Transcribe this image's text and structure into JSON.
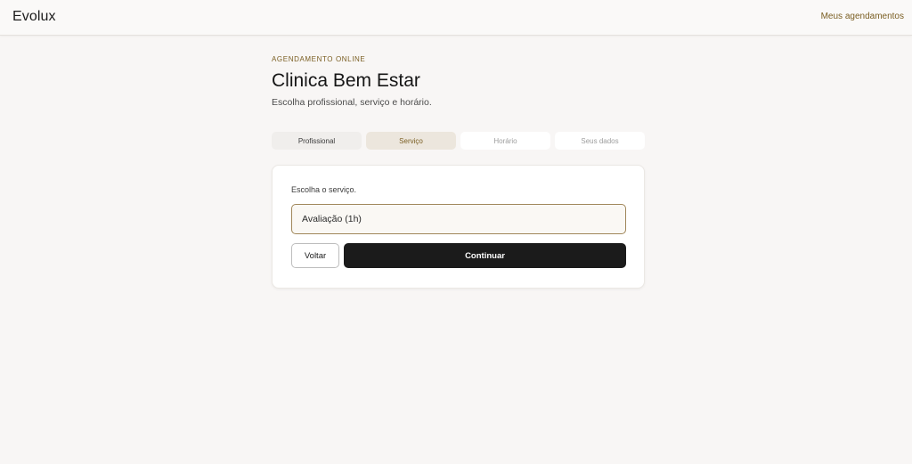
{
  "header": {
    "brand": "Evolux",
    "my_appointments_link": "Meus agendamentos"
  },
  "intro": {
    "eyebrow": "AGENDAMENTO ONLINE",
    "clinic_name": "Clinica Bem Estar",
    "subtitle": "Escolha profissional, serviço e horário."
  },
  "steps": [
    {
      "label": "Profissional",
      "state": "done"
    },
    {
      "label": "Serviço",
      "state": "active"
    },
    {
      "label": "Horário",
      "state": "future"
    },
    {
      "label": "Seus dados",
      "state": "future"
    }
  ],
  "form": {
    "service_label": "Escolha o serviço.",
    "service_selected": "Avaliação (1h)",
    "back_label": "Voltar",
    "continue_label": "Continuar"
  },
  "colors": {
    "accent": "#7a5e22",
    "background": "#f8f6f5",
    "primary_button": "#1b1b1b"
  }
}
